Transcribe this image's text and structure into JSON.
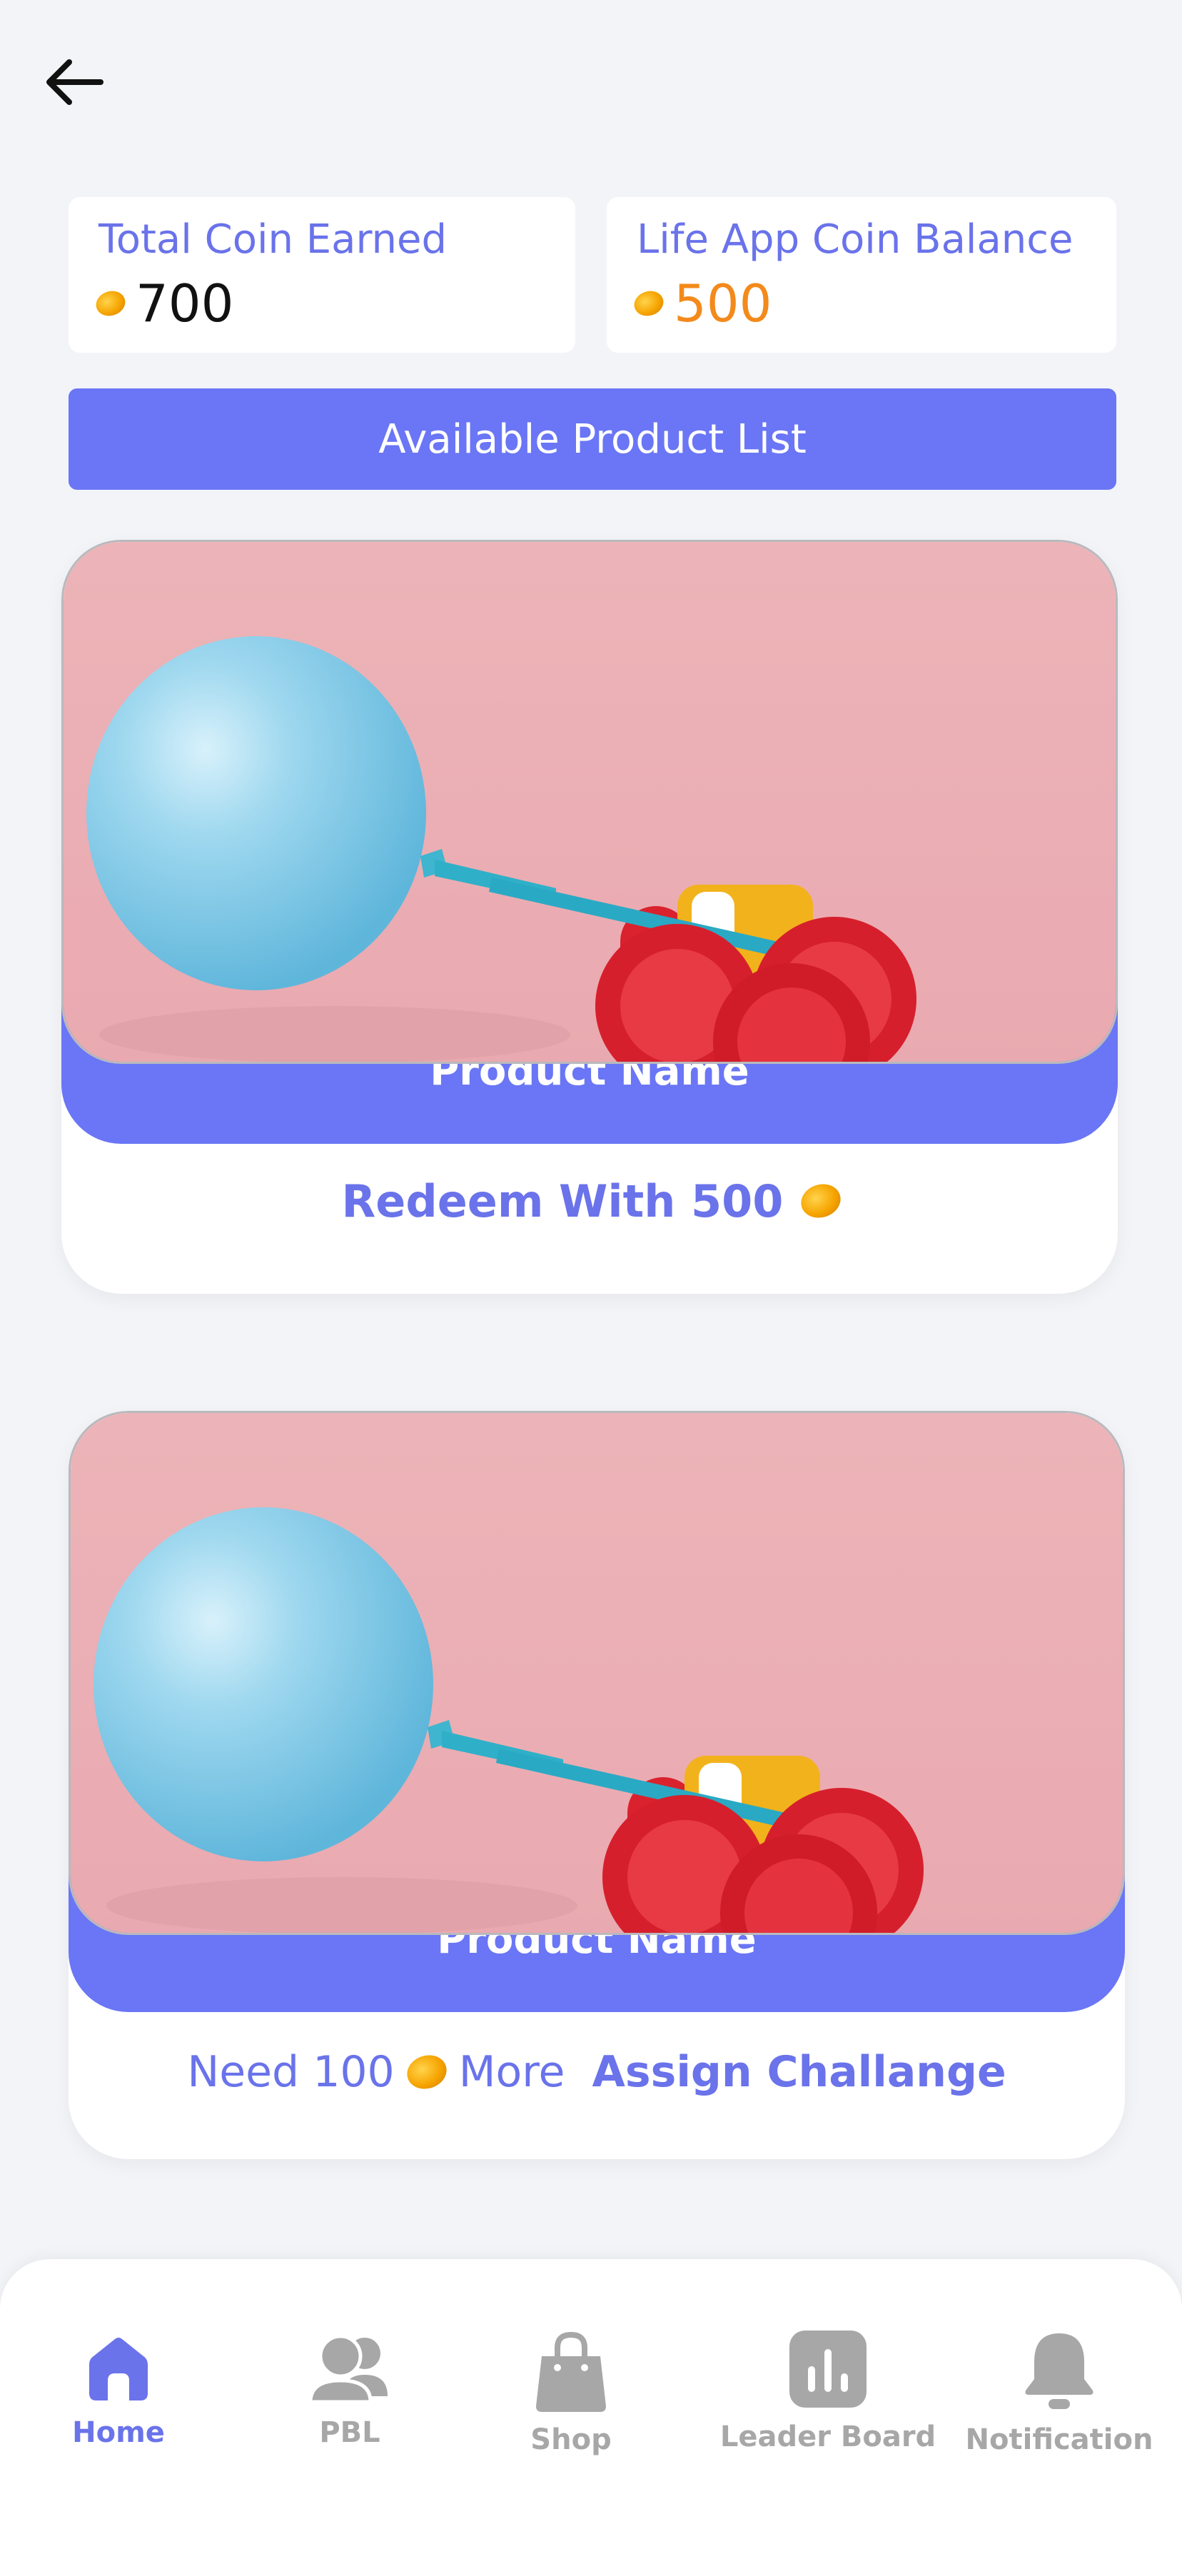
{
  "header": {
    "back_icon": "arrow-left-icon"
  },
  "stats": {
    "total_earned": {
      "title": "Total Coin Earned",
      "value": "700",
      "icon": "coin-icon"
    },
    "balance": {
      "title": "Life App Coin Balance",
      "value": "500",
      "icon": "coin-icon"
    }
  },
  "banner": {
    "label": "Available Product List"
  },
  "products": [
    {
      "name": "Product Name",
      "image": "balloon-car-image",
      "redeem_label": "Redeem With 500"
    },
    {
      "name": "Product Name",
      "image": "balloon-car-image",
      "need_prefix": "Need 100",
      "need_suffix": "More",
      "assign_label": "Assign Challange"
    }
  ],
  "nav": {
    "items": [
      {
        "label": "Home",
        "icon": "home-icon",
        "active": true
      },
      {
        "label": "PBL",
        "icon": "users-icon",
        "active": false
      },
      {
        "label": "Shop",
        "icon": "shopping-bag-icon",
        "active": false
      },
      {
        "label": "Leader Board",
        "icon": "leaderboard-icon",
        "active": false
      },
      {
        "label": "Notification",
        "icon": "bell-icon",
        "active": false
      }
    ]
  },
  "colors": {
    "accent": "#6a76f5",
    "text_accent": "#6a73ea",
    "balance_orange": "#f38a1b",
    "inactive": "#a7a7a7",
    "background": "#f3f4f8"
  }
}
